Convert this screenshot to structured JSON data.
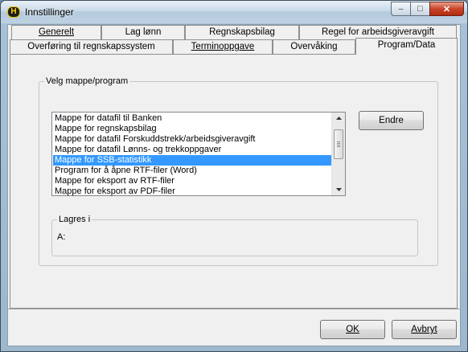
{
  "window": {
    "title": "Innstillinger",
    "app_icon_letter": "H",
    "min_glyph": "–",
    "max_glyph": "□",
    "close_glyph": "✕"
  },
  "tabs_row1": [
    "Generelt",
    "Lag lønn",
    "Regnskapsbilag",
    "Regel for arbeidsgiveravgift"
  ],
  "tabs_row2": [
    "Overføring til regnskapssystem",
    "Terminoppgave",
    "Overvåking",
    "Program/Data"
  ],
  "active_tab": "Program/Data",
  "folder_group": {
    "label": "Velg mappe/program",
    "items": [
      "Mappe for datafil til Banken",
      "Mappe for regnskapsbilag",
      "Mappe for datafil Forskuddstrekk/arbeidsgiveravgift",
      "Mappe for datafil Lønns- og trekkoppgaver",
      "Mappe for SSB-statistikk",
      "Program for å åpne RTF-filer (Word)",
      "Mappe for eksport av RTF-filer",
      "Mappe for eksport av PDF-filer"
    ],
    "selected_index": 4,
    "change_button": "Endre"
  },
  "saved_in": {
    "label": "Lagres i",
    "value": "A:"
  },
  "footer": {
    "ok_label": "OK",
    "cancel_label": "Avbryt"
  },
  "colors": {
    "selection": "#3399ff",
    "close_button": "#c8442a"
  }
}
